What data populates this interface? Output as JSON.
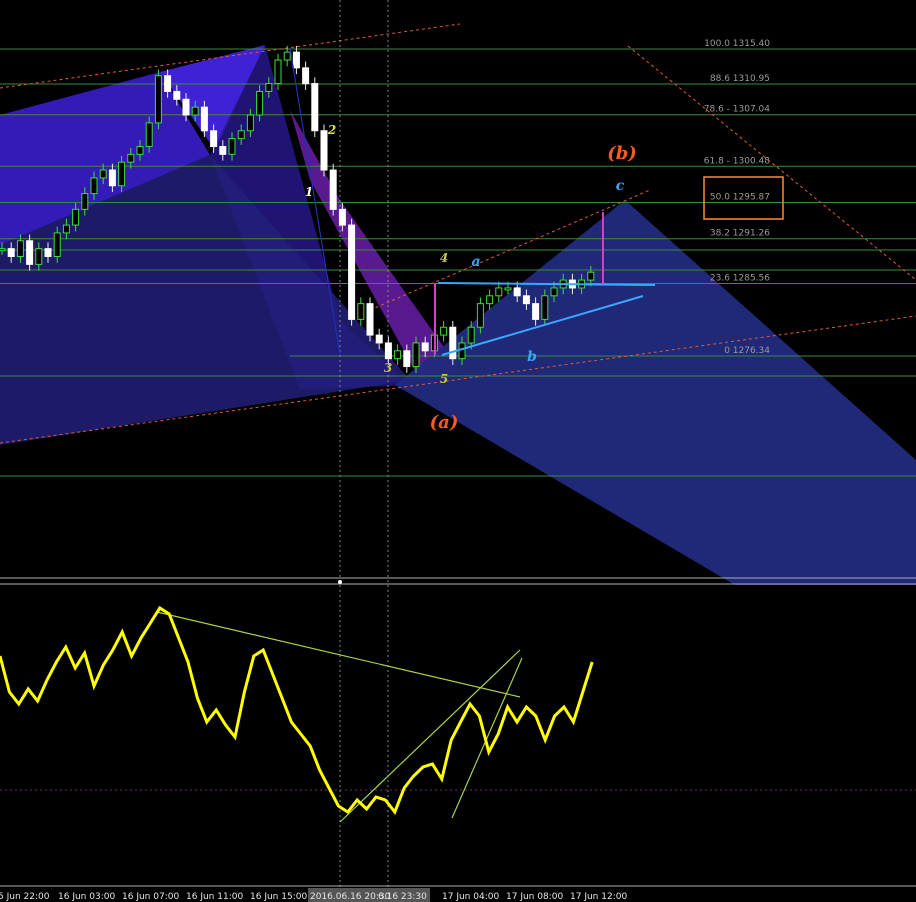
{
  "chart_data": {
    "type": "candlestick",
    "symbol_context": "Gold H1 (MetaTrader)",
    "price_range": [
      1262,
      1319
    ],
    "fibonacci_levels": [
      {
        "level": "100.0",
        "price": 1315.4
      },
      {
        "level": "88.6",
        "price": 1310.95
      },
      {
        "level": "78.6 -",
        "price": 1307.04
      },
      {
        "level": "61.8 -",
        "price": 1300.48
      },
      {
        "level": "50.0",
        "price": 1295.87
      },
      {
        "level": "38.2",
        "price": 1291.26
      },
      {
        "level": "23.6",
        "price": 1285.56
      },
      {
        "level": "0",
        "price": 1276.34
      }
    ],
    "highlighted_level": "50.0",
    "wave_labels": [
      {
        "text": "1",
        "color": "#ffffff"
      },
      {
        "text": "2",
        "color": "#e0e060"
      },
      {
        "text": "3",
        "color": "#c8c832"
      },
      {
        "text": "4",
        "color": "#c8c832"
      },
      {
        "text": "5",
        "color": "#c8c832"
      },
      {
        "text": "a",
        "color": "#39a7ff"
      },
      {
        "text": "b",
        "color": "#39a7ff"
      },
      {
        "text": "c",
        "color": "#39a7ff"
      },
      {
        "text": "(a)",
        "color": "#ff5a1f"
      },
      {
        "text": "(b)",
        "color": "#ff5a1f"
      }
    ],
    "time_axis_labels": [
      "5 Jun 22:00",
      "16 Jun 03:00",
      "16 Jun 07:00",
      "16 Jun 11:00",
      "16 Jun 15:00",
      "17 Jun 04:00",
      "17 Jun 08:00",
      "17 Jun 12:00"
    ],
    "crosshair_labels": [
      "2016.06.16 20:30",
      "6.16 23:30"
    ],
    "oscillator": {
      "type": "line",
      "color": "#ffff00",
      "values": [
        72,
        60,
        56,
        61,
        57,
        64,
        70,
        75,
        68,
        73,
        62,
        69,
        74,
        80,
        72,
        78,
        83,
        88,
        86,
        78,
        70,
        58,
        50,
        54,
        49,
        45,
        60,
        72,
        74,
        66,
        58,
        50,
        46,
        42,
        34,
        28,
        22,
        20,
        24,
        21,
        25,
        24,
        20,
        28,
        32,
        35,
        36,
        31,
        44,
        50,
        56,
        52,
        40,
        46,
        55,
        50,
        55,
        52,
        44,
        52,
        55,
        50,
        60,
        70
      ]
    }
  }
}
